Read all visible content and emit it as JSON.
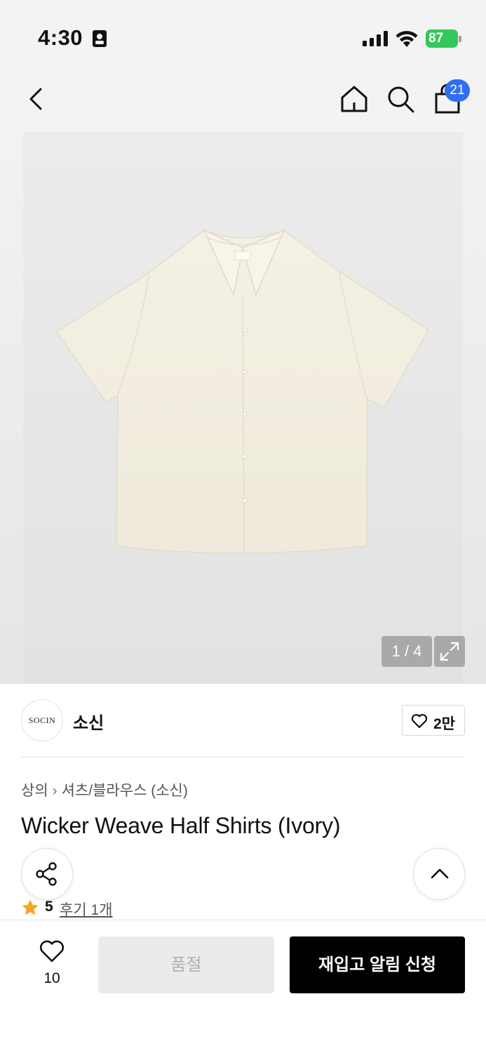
{
  "status_bar": {
    "time": "4:30",
    "battery": "87"
  },
  "header": {
    "cart_count": "21"
  },
  "gallery": {
    "counter": "1 / 4"
  },
  "brand": {
    "logo_text": "SOCIN",
    "name": "소신",
    "like_count": "2만"
  },
  "product": {
    "breadcrumb": [
      "상의",
      "셔츠/블라우스 (소신)"
    ],
    "title": "Wicker Weave Half Shirts (Ivory)",
    "rating": "5",
    "review_link": "후기 1개"
  },
  "bottom_bar": {
    "wish_count": "10",
    "soldout_label": "품절",
    "restock_label": "재입고 알림 신청"
  },
  "colors": {
    "badge": "#2f6ff0",
    "battery": "#34c759",
    "star": "#f5a623",
    "primary_button": "#000000",
    "disabled_button": "#ebebeb"
  },
  "icons": [
    "back-icon",
    "home-icon",
    "search-icon",
    "shopping-bag-icon",
    "expand-icon",
    "heart-icon",
    "share-icon",
    "chevron-up-icon",
    "star-icon"
  ]
}
